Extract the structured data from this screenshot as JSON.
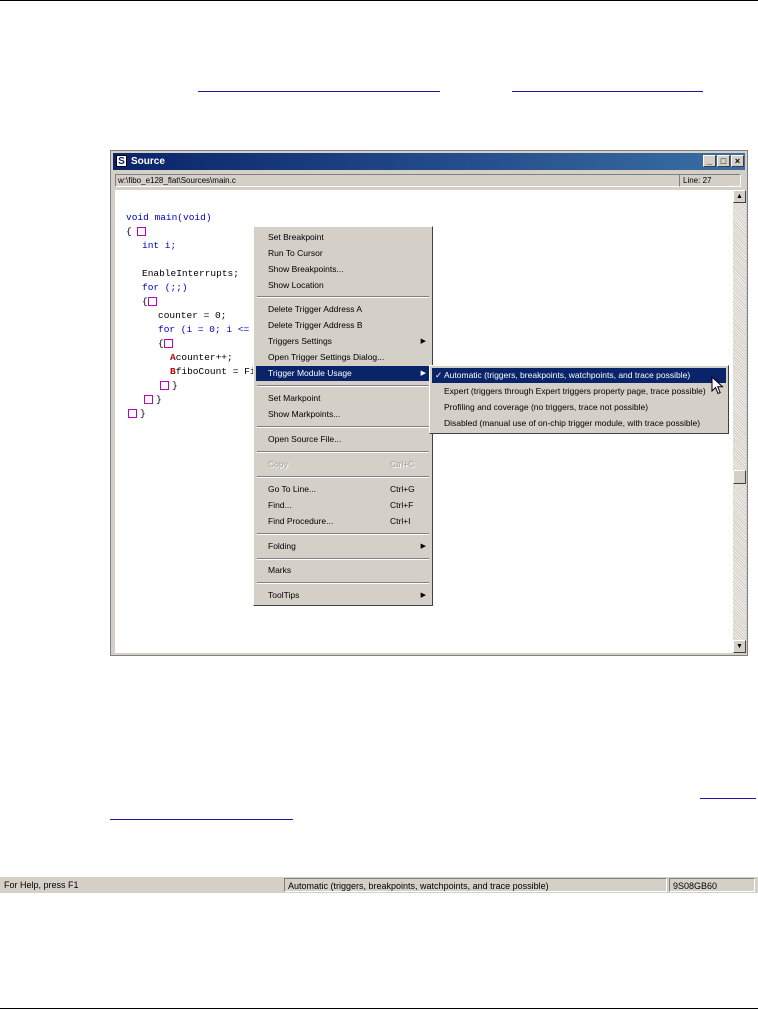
{
  "window": {
    "title": "Source",
    "icon_letter": "S",
    "path": "w:\\fibo_e128_flat\\Sources\\main.c",
    "line_indicator": "Line: 27"
  },
  "code_lines": [
    "void main(void)",
    "{",
    "int i;",
    "EnableInterrupts;",
    "for (;;)",
    "{",
    "counter = 0;",
    "for (i = 0; i <= ",
    "{",
    "counter++;",
    "fiboCount = Fil",
    "}",
    "}",
    "}"
  ],
  "marker_letters": [
    "A",
    "B"
  ],
  "context_menu": {
    "items": [
      {
        "label": "Set Breakpoint"
      },
      {
        "label": "Run To Cursor"
      },
      {
        "label": "Show Breakpoints..."
      },
      {
        "label": "Show Location"
      },
      {
        "label": "Delete Trigger Address A"
      },
      {
        "label": "Delete Trigger Address B"
      },
      {
        "label": "Triggers Settings"
      },
      {
        "label": "Open Trigger Settings Dialog..."
      },
      {
        "label": "Trigger Module Usage"
      },
      {
        "label": "Set Markpoint"
      },
      {
        "label": "Show Markpoints..."
      },
      {
        "label": "Open Source File..."
      },
      {
        "label": "Copy",
        "shortcut": "Ctrl+C"
      },
      {
        "label": "Go To Line...",
        "shortcut": "Ctrl+G"
      },
      {
        "label": "Find...",
        "shortcut": "Ctrl+F"
      },
      {
        "label": "Find Procedure...",
        "shortcut": "Ctrl+I"
      },
      {
        "label": "Folding"
      },
      {
        "label": "Marks"
      },
      {
        "label": "ToolTips"
      }
    ]
  },
  "submenu": {
    "items": [
      {
        "label": "Automatic (triggers, breakpoints, watchpoints, and trace possible)",
        "checked": "✓"
      },
      {
        "label": "Expert (triggers through Expert triggers property page, trace possible)"
      },
      {
        "label": "Profiling and coverage (no triggers, trace not possible)"
      },
      {
        "label": "Disabled (manual use of on-chip trigger module, with trace possible)"
      }
    ]
  },
  "status_bar": {
    "help": "For Help, press F1",
    "mode": "Automatic (triggers, breakpoints, watchpoints, and trace possible)",
    "device": "9S08GB60"
  },
  "colors": {
    "title_bar": "#0a246a",
    "highlight": "#0a246a",
    "keyword": "#0000c0",
    "marker": "#c000c0"
  }
}
